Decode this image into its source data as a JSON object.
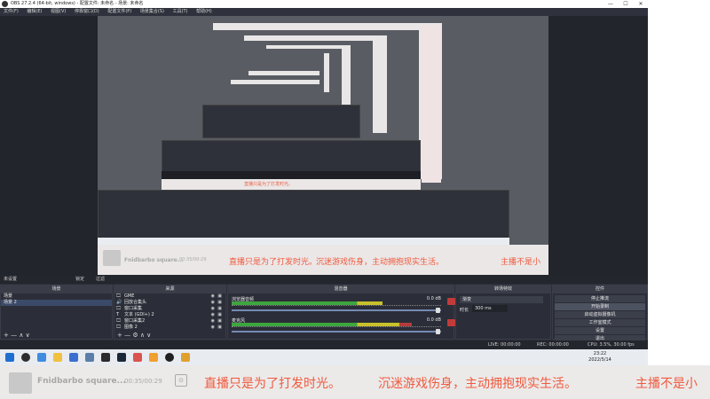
{
  "window": {
    "title": "OBS 27.2.4 (64-bit, windows) - 配置文件: 未命名 - 场景: 未命名",
    "controls": [
      "—",
      "☐",
      "✕"
    ]
  },
  "menu": [
    "文件(F)",
    "编辑(E)",
    "视图(V)",
    "停靠窗口(D)",
    "配置文件(P)",
    "场景集合(S)",
    "工具(T)",
    "帮助(H)"
  ],
  "preview": {
    "chat": {
      "name": "Fnidbarbo square...",
      "time": "00:35/00:29",
      "messages": [
        "直播只是为了打发时光。",
        "沉迷游戏伤身，主动拥抱现实生活。",
        "主播不是小"
      ]
    }
  },
  "docks_header": {
    "label": "未设置",
    "buttons": [
      "锁定",
      "过滤"
    ]
  },
  "scenes": {
    "title": "场景",
    "items": [
      "场景",
      "场景 2"
    ],
    "selected": 1,
    "footer": "+ — ∧ ∨"
  },
  "sources": {
    "title": "来源",
    "items": [
      {
        "icon": "🖵",
        "name": "GME"
      },
      {
        "icon": "🔊",
        "name": "回放合集头"
      },
      {
        "icon": "🖵",
        "name": "窗口采集"
      },
      {
        "icon": "T",
        "name": "文本 (GDI+) 2"
      },
      {
        "icon": "🖵",
        "name": "窗口采集2"
      },
      {
        "icon": "🖵",
        "name": "图像 2"
      }
    ],
    "footer": "+ — ⚙ ∧ ∨"
  },
  "mixer": {
    "title": "混音器",
    "channels": [
      {
        "label": "浏览器音频",
        "db": "0.0 dB",
        "level": 0.72
      },
      {
        "label": "麦克风",
        "db": "0.0 dB",
        "level": 0.86
      }
    ]
  },
  "transitions": {
    "title": "转场特效",
    "mode": "渐变",
    "duration_label": "时长",
    "duration_value": "300 ms"
  },
  "controls": {
    "title": "控件",
    "buttons": [
      "停止推流",
      "开始录制",
      "启动虚拟摄像机",
      "工作室模式",
      "设置",
      "退出"
    ],
    "highlight": 1
  },
  "statusbar": {
    "live": "LIVE: 00:00:00",
    "rec": "REC: 00:00:00",
    "cpu": "CPU: 3.5%, 30.00 fps"
  },
  "clock": {
    "time": "23:22",
    "date": "2022/5/14"
  },
  "bottom_chat": {
    "name": "Fnidbarbo square...",
    "time": "00:35/00:29",
    "messages": [
      "直播只是为了打发时光。",
      "沉迷游戏伤身，主动拥抱现实生活。",
      "主播不是小"
    ]
  },
  "colors": {
    "obs_bg": "#2b2e38",
    "chat_text": "#ef5a3d",
    "mute": "#c23b3b",
    "selection": "#3b4a68"
  }
}
